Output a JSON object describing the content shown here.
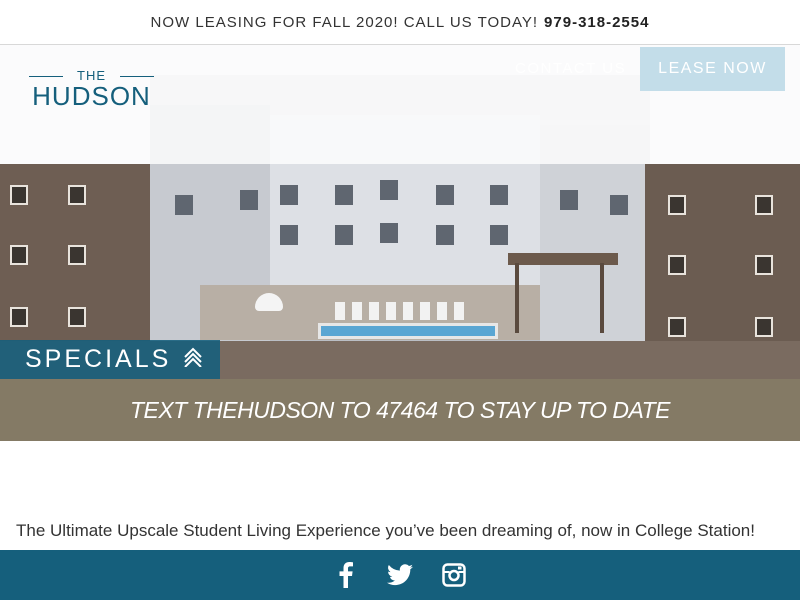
{
  "announcement": {
    "text": "NOW LEASING FOR FALL 2020! CALL US TODAY!",
    "phone": "979-318-2554"
  },
  "logo": {
    "top": "THE",
    "name": "HUDSON"
  },
  "nav": {
    "contact": "CONTACT US",
    "lease": "LEASE NOW"
  },
  "hero": {
    "specials_label": "SPECIALS",
    "specials_icon": "double-chevron-up-icon"
  },
  "banner": {
    "text": "TEXT THEHUDSON TO 47464 TO STAY UP TO DATE"
  },
  "tagline": "The Ultimate Upscale Student Living Experience you’ve been dreaming of, now in College Station!",
  "footer": {
    "icons": [
      "facebook-icon",
      "twitter-icon",
      "instagram-icon"
    ]
  },
  "colors": {
    "brand": "#155f7c",
    "banner": "#847a65",
    "lease_button": "#c3dde9"
  }
}
